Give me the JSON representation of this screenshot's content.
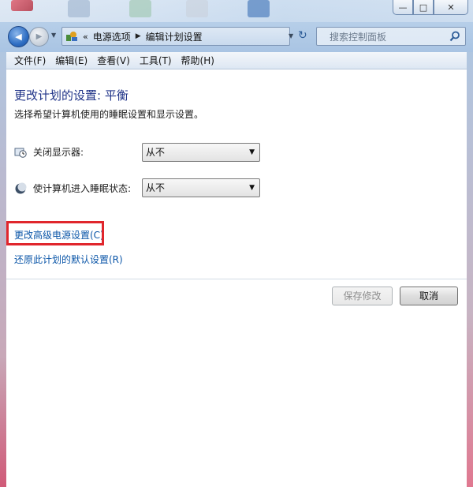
{
  "window": {
    "caption_buttons": {
      "minimize": "—",
      "maximize": "□",
      "close": "✕"
    }
  },
  "nav": {
    "back_glyph": "◀",
    "forward_glyph": "▶",
    "breadcrumb_prefix": "«",
    "breadcrumb": [
      "电源选项",
      "编辑计划设置"
    ],
    "search_placeholder": "搜索控制面板"
  },
  "menu": [
    "文件(F)",
    "编辑(E)",
    "查看(V)",
    "工具(T)",
    "帮助(H)"
  ],
  "main": {
    "title": "更改计划的设置: 平衡",
    "subtitle": "选择希望计算机使用的睡眠设置和显示设置。",
    "settings": [
      {
        "label": "关闭显示器:",
        "value": "从不",
        "icon": "monitor-clock-icon"
      },
      {
        "label": "使计算机进入睡眠状态:",
        "value": "从不",
        "icon": "moon-sleep-icon"
      }
    ],
    "links": {
      "advanced": "更改高级电源设置(C)",
      "restore": "还原此计划的默认设置(R)"
    },
    "buttons": {
      "save": "保存修改",
      "cancel": "取消"
    }
  },
  "colors": {
    "title": "#1e3287",
    "link": "#0b56a8",
    "highlight": "#e0262c"
  }
}
